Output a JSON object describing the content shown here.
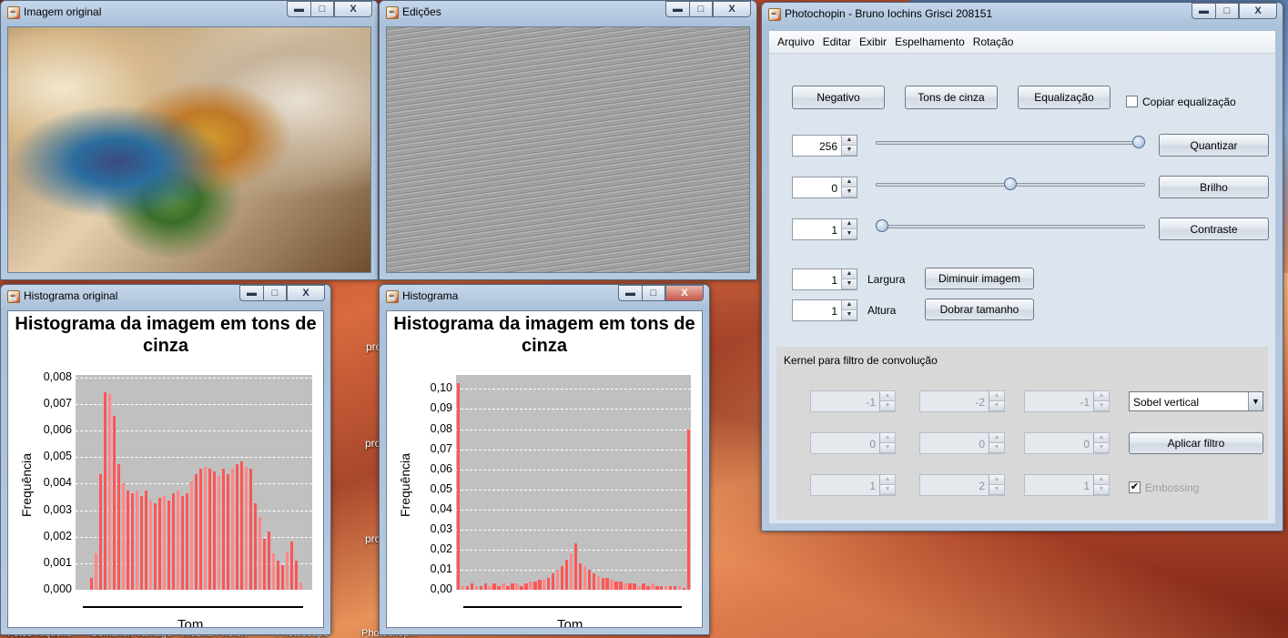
{
  "windows": {
    "original": {
      "title": "Imagem original"
    },
    "edits": {
      "title": "Edições"
    },
    "hist_original": {
      "title": "Histograma original"
    },
    "hist_edit": {
      "title": "Histograma"
    },
    "main": {
      "title": "Photochopin - Bruno Iochins Grisci 208151"
    }
  },
  "title_buttons": {
    "minimize": "▬",
    "maximize": "□",
    "close": "X"
  },
  "desktop": {
    "labels": [
      "pro",
      "pro",
      "pro"
    ],
    "taskbar": [
      "Fotos Riquens",
      "Semantik Vantage",
      "Mozilla Firefox",
      "Photoscape",
      "Photochopin"
    ]
  },
  "menu": [
    "Arquivo",
    "Editar",
    "Exibir",
    "Espelhamento",
    "Rotação"
  ],
  "buttons": {
    "negativo": "Negativo",
    "tons": "Tons de cinza",
    "equal": "Equalização",
    "quantizar": "Quantizar",
    "brilho": "Brilho",
    "contraste": "Contraste",
    "diminuir": "Diminuir imagem",
    "dobrar": "Dobrar tamanho",
    "aplicar": "Aplicar filtro"
  },
  "checkboxes": {
    "copiar": {
      "label": "Copiar equalização",
      "checked": false
    },
    "embossing": {
      "label": "Embossing",
      "checked": true
    }
  },
  "spinners": {
    "quantizar": "256",
    "brilho": "0",
    "contraste": "1",
    "largura": "1",
    "altura": "1"
  },
  "sliders": {
    "quantizar": 1.0,
    "brilho": 0.5,
    "contraste": 0.0
  },
  "labels": {
    "largura": "Largura",
    "altura": "Altura",
    "kernel": "Kernel para filtro de convolução"
  },
  "kernel": [
    [
      "-1",
      "-2",
      "-1"
    ],
    [
      "0",
      "0",
      "0"
    ],
    [
      "1",
      "2",
      "1"
    ]
  ],
  "filter_select": {
    "value": "Sobel vertical"
  },
  "chart_data": [
    {
      "type": "bar",
      "title": "Histograma da imagem em tons de cinza",
      "xlabel": "Tom",
      "ylabel": "Frequência",
      "yticks": [
        "0,000",
        "0,001",
        "0,002",
        "0,003",
        "0,004",
        "0,005",
        "0,006",
        "0,007",
        "0,008"
      ],
      "ylim": [
        0,
        0.0089
      ],
      "xlim": [
        0,
        255
      ],
      "x": [
        0,
        5,
        10,
        15,
        20,
        25,
        30,
        35,
        40,
        45,
        50,
        55,
        60,
        65,
        70,
        75,
        80,
        85,
        90,
        95,
        100,
        105,
        110,
        115,
        120,
        125,
        130,
        135,
        140,
        145,
        150,
        155,
        160,
        165,
        170,
        175,
        180,
        185,
        190,
        195,
        200,
        205,
        210,
        215,
        220,
        225,
        230,
        235,
        240,
        245,
        250,
        255
      ],
      "values": [
        0,
        0,
        0,
        0.0005,
        0.0015,
        0.0048,
        0.0082,
        0.0081,
        0.0072,
        0.0052,
        0.0044,
        0.0041,
        0.004,
        0.0041,
        0.0039,
        0.0041,
        0.0037,
        0.0036,
        0.0038,
        0.0039,
        0.0037,
        0.004,
        0.0041,
        0.0039,
        0.004,
        0.0045,
        0.0048,
        0.005,
        0.0051,
        0.005,
        0.0049,
        0.0047,
        0.005,
        0.0048,
        0.005,
        0.0052,
        0.0053,
        0.0051,
        0.005,
        0.0036,
        0.003,
        0.0021,
        0.0024,
        0.0015,
        0.0012,
        0.001,
        0.0016,
        0.002,
        0.0012,
        0.0003,
        0,
        0
      ]
    },
    {
      "type": "bar",
      "title": "Histograma da imagem em tons de cinza",
      "xlabel": "Tom",
      "ylabel": "Frequência",
      "yticks": [
        "0,00",
        "0,01",
        "0,02",
        "0,03",
        "0,04",
        "0,05",
        "0,06",
        "0,07",
        "0,08",
        "0,09",
        "0,10"
      ],
      "ylim": [
        0,
        0.107
      ],
      "xlim": [
        0,
        255
      ],
      "x": [
        0,
        5,
        10,
        15,
        20,
        25,
        30,
        35,
        40,
        45,
        50,
        55,
        60,
        65,
        70,
        75,
        80,
        85,
        90,
        95,
        100,
        105,
        110,
        115,
        120,
        125,
        130,
        135,
        140,
        145,
        150,
        155,
        160,
        165,
        170,
        175,
        180,
        185,
        190,
        195,
        200,
        205,
        210,
        215,
        220,
        225,
        230,
        235,
        240,
        245,
        250,
        255
      ],
      "values": [
        0.103,
        0.002,
        0.002,
        0.003,
        0.002,
        0.002,
        0.003,
        0.002,
        0.003,
        0.002,
        0.003,
        0.002,
        0.003,
        0.003,
        0.002,
        0.003,
        0.004,
        0.004,
        0.005,
        0.005,
        0.006,
        0.008,
        0.01,
        0.012,
        0.015,
        0.018,
        0.023,
        0.013,
        0.012,
        0.01,
        0.008,
        0.007,
        0.006,
        0.006,
        0.005,
        0.004,
        0.004,
        0.003,
        0.003,
        0.003,
        0.002,
        0.003,
        0.002,
        0.003,
        0.002,
        0.002,
        0.002,
        0.002,
        0.002,
        0.002,
        0.001,
        0.08
      ]
    }
  ]
}
